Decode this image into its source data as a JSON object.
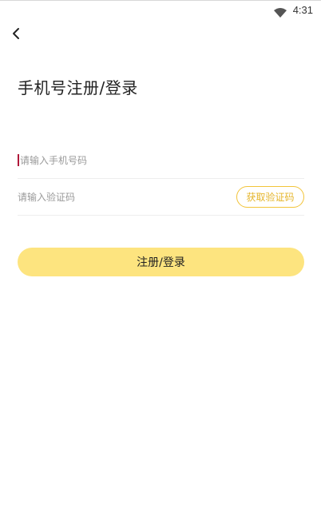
{
  "status_bar": {
    "time": "4:31",
    "icons": [
      "wifi-icon"
    ]
  },
  "nav": {
    "back_icon": "chevron-left-icon"
  },
  "page": {
    "title": "手机号注册/登录"
  },
  "form": {
    "phone_placeholder": "请输入手机号码",
    "phone_value": "",
    "code_placeholder": "请输入验证码",
    "code_value": "",
    "get_code_label": "获取验证码",
    "submit_label": "注册/登录"
  },
  "colors": {
    "accent": "#fde47f",
    "accent_text": "#e5b52a",
    "caret": "#b0183a"
  }
}
